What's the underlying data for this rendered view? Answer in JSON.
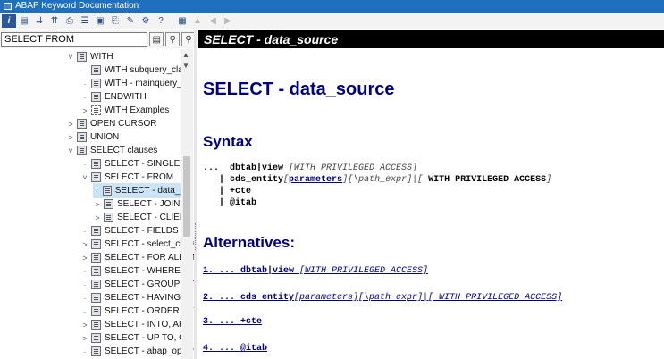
{
  "window": {
    "title": "ABAP Keyword Documentation"
  },
  "search": {
    "value": "SELECT FROM"
  },
  "content": {
    "header": "SELECT - data_source",
    "title": "SELECT - data_source",
    "syntax_heading": "Syntax",
    "syntax_lines": [
      {
        "prefix": "...  ",
        "main": "dbtab|view ",
        "it": "[WITH PRIVILEGED ACCESS]"
      },
      {
        "prefix": "   | ",
        "main": "cds_entity",
        "it1": "[",
        "link": "parameters",
        "it2": "][\\path_expr]|[ ",
        "main2": "WITH PRIVILEGED ACCESS",
        "it3": "]"
      },
      {
        "prefix": "   | ",
        "main": "+cte"
      },
      {
        "prefix": "   | ",
        "main": "@itab"
      }
    ],
    "alternatives_heading": "Alternatives:",
    "alternatives": [
      {
        "num": "1. ... ",
        "text": "dbtab|view ",
        "rest": "[WITH PRIVILEGED ACCESS]"
      },
      {
        "num": "2. ... ",
        "text": "cds entity",
        "rest": "[parameters][\\path expr]|[ WITH PRIVILEGED ACCESS]"
      },
      {
        "num": "3. ... ",
        "text": "+cte",
        "rest": ""
      },
      {
        "num": "4. ... ",
        "text": "@itab",
        "rest": ""
      }
    ]
  },
  "tree": [
    {
      "label": "WITH",
      "indent": 0,
      "toggle": "˅"
    },
    {
      "label": "WITH subquery_clau",
      "indent": 1,
      "toggle": "·"
    },
    {
      "label": "WITH - mainquery_c",
      "indent": 1,
      "toggle": "·"
    },
    {
      "label": "ENDWITH",
      "indent": 1,
      "toggle": "·"
    },
    {
      "label": "WITH Examples",
      "indent": 1,
      "toggle": ">",
      "ex": true
    },
    {
      "label": "OPEN CURSOR",
      "indent": 0,
      "toggle": ">"
    },
    {
      "label": "UNION",
      "indent": 0,
      "toggle": ">"
    },
    {
      "label": "SELECT clauses",
      "indent": 0,
      "toggle": "˅"
    },
    {
      "label": "SELECT - SINGLE",
      "indent": 1,
      "toggle": "·"
    },
    {
      "label": "SELECT - FROM",
      "indent": 1,
      "toggle": "˅"
    },
    {
      "label": "SELECT - data_so",
      "indent": 2,
      "toggle": "·",
      "selected": true
    },
    {
      "label": "SELECT - JOIN",
      "indent": 2,
      "toggle": ">"
    },
    {
      "label": "SELECT - CLIENT",
      "indent": 2,
      "toggle": ">"
    },
    {
      "label": "SELECT - FIELDS",
      "indent": 1,
      "toggle": "·"
    },
    {
      "label": "SELECT - select_claus",
      "indent": 1,
      "toggle": ">"
    },
    {
      "label": "SELECT - FOR ALL EN",
      "indent": 1,
      "toggle": ">"
    },
    {
      "label": "SELECT - WHERE",
      "indent": 1,
      "toggle": "·"
    },
    {
      "label": "SELECT - GROUP BY",
      "indent": 1,
      "toggle": "·"
    },
    {
      "label": "SELECT - HAVING",
      "indent": 1,
      "toggle": "·"
    },
    {
      "label": "SELECT - ORDER BY",
      "indent": 1,
      "toggle": "·"
    },
    {
      "label": "SELECT - INTO, APPI",
      "indent": 1,
      "toggle": ">"
    },
    {
      "label": "SELECT - UP TO, OF",
      "indent": 1,
      "toggle": ">"
    },
    {
      "label": "SELECT - abap_optior",
      "indent": 1,
      "toggle": "·"
    }
  ]
}
